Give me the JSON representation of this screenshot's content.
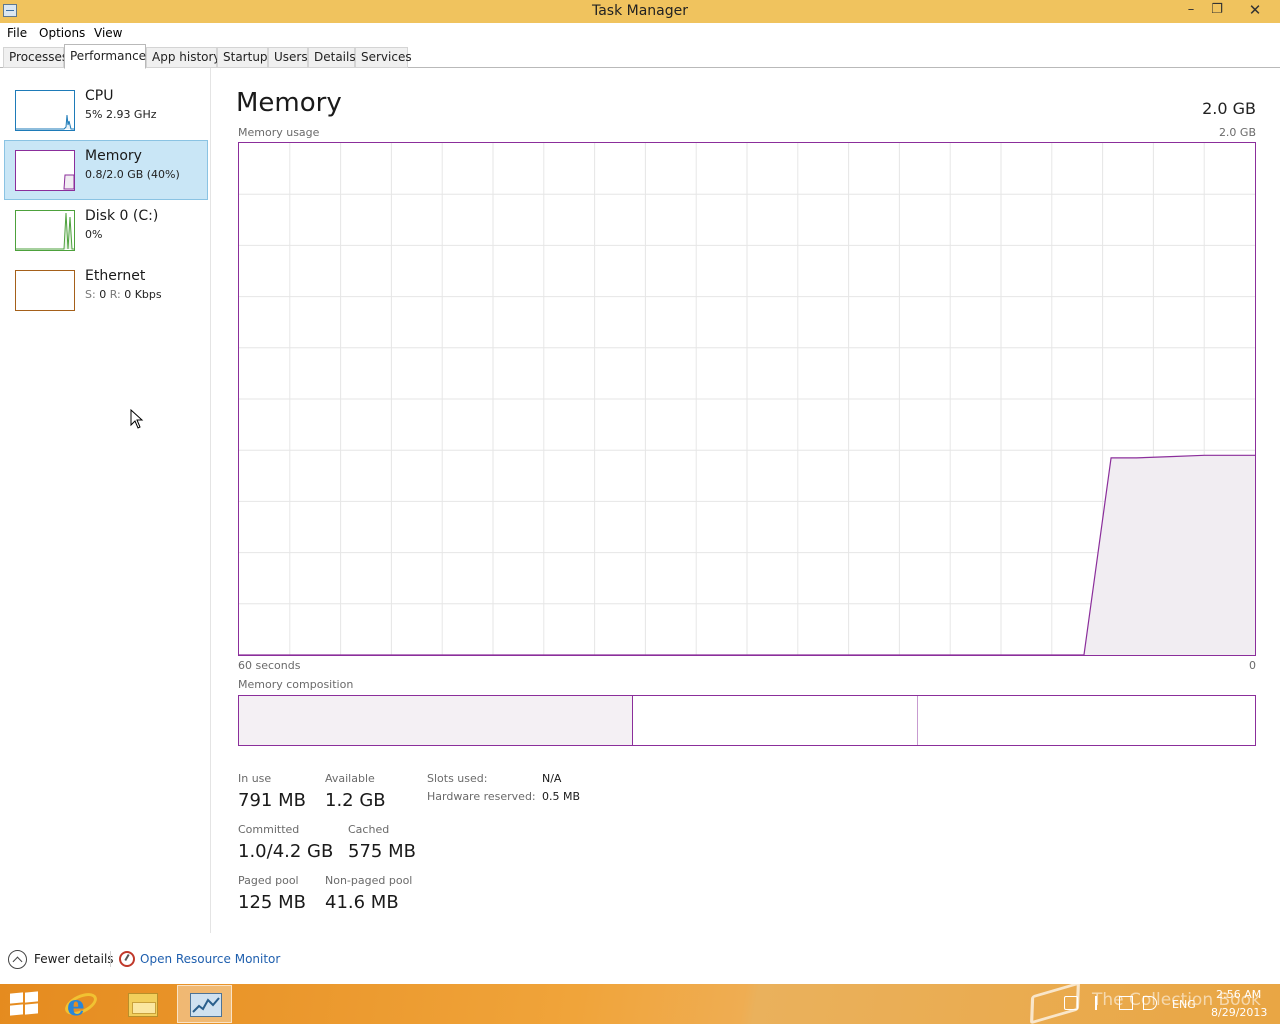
{
  "window": {
    "title": "Task Manager",
    "minimize_glyph": "–",
    "maximize_glyph": "❐",
    "close_glyph": "✕"
  },
  "menu": {
    "file": "File",
    "options": "Options",
    "view": "View"
  },
  "tabs": [
    {
      "label": "Processes"
    },
    {
      "label": "Performance",
      "active": true
    },
    {
      "label": "App history"
    },
    {
      "label": "Startup"
    },
    {
      "label": "Users"
    },
    {
      "label": "Details"
    },
    {
      "label": "Services"
    }
  ],
  "sidebar": {
    "items": [
      {
        "name": "CPU",
        "sub": "5%  2.93 GHz",
        "color": "#1e7bb8"
      },
      {
        "name": "Memory",
        "sub": "0.8/2.0 GB (40%)",
        "color": "#8b2e9b",
        "selected": true
      },
      {
        "name": "Disk 0 (C:)",
        "sub": "0%",
        "color": "#4da13c"
      },
      {
        "name": "Ethernet",
        "sub_prefix_s": "S:",
        "sub_s": "0",
        "sub_prefix_r": "R:",
        "sub_r": "0 Kbps",
        "color": "#a5601a"
      }
    ]
  },
  "main": {
    "title": "Memory",
    "total": "2.0 GB",
    "usage_label": "Memory usage",
    "usage_max": "2.0 GB",
    "x_left": "60 seconds",
    "x_right": "0",
    "composition_label": "Memory composition",
    "stats": {
      "in_use_label": "In use",
      "in_use": "791 MB",
      "available_label": "Available",
      "available": "1.2 GB",
      "committed_label": "Committed",
      "committed": "1.0/4.2 GB",
      "cached_label": "Cached",
      "cached": "575 MB",
      "paged_pool_label": "Paged pool",
      "paged_pool": "125 MB",
      "nonpaged_pool_label": "Non-paged pool",
      "nonpaged_pool": "41.6 MB",
      "slots_used_label": "Slots used:",
      "slots_used": "N/A",
      "hw_reserved_label": "Hardware reserved:",
      "hw_reserved": "0.5 MB"
    }
  },
  "footer": {
    "fewer_details": "Fewer details",
    "open_resource_monitor": "Open Resource Monitor"
  },
  "taskbar": {
    "lang": "ENG",
    "time": "2:56 AM",
    "date": "8/29/2013",
    "watermark": "The Collection Book"
  },
  "colors": {
    "memory_accent": "#8b2e9b",
    "memory_fill": "#f1edf2",
    "selected_bg": "#c9e6f6",
    "link": "#1f5fae",
    "titlebar": "#f0c35e"
  },
  "chart_data": {
    "type": "area",
    "title": "Memory usage",
    "xlabel": "",
    "ylabel": "",
    "x_range_label": [
      "60 seconds",
      "0"
    ],
    "ylim": [
      0,
      2.0
    ],
    "y_unit": "GB",
    "x": [
      60,
      10.1,
      8.5,
      7,
      5,
      3,
      1.5,
      0
    ],
    "values": [
      0,
      0,
      0.77,
      0.77,
      0.775,
      0.78,
      0.78,
      0.78
    ],
    "grid": true
  },
  "composition": {
    "in_use_fraction": 0.39,
    "standby_fraction": 0.28,
    "free_fraction": 0.33
  }
}
